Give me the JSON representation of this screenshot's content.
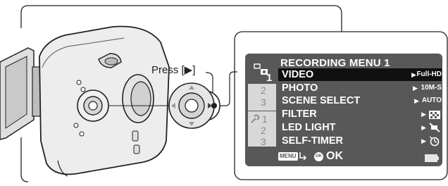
{
  "callout": {
    "press_label": "Press [▶]"
  },
  "menu": {
    "title": "RECORDING MENU 1",
    "tabs": {
      "camera_top": "□",
      "camera_1": "1",
      "camera_2": "2",
      "camera_3": "3",
      "setup_1": "1",
      "setup_2": "2",
      "setup_3": "3"
    },
    "items": [
      {
        "label": "VIDEO",
        "value": "Full-HD",
        "selected": true
      },
      {
        "label": "PHOTO",
        "value": "10M-S",
        "selected": false
      },
      {
        "label": "SCENE SELECT",
        "value": "AUTO",
        "selected": false
      },
      {
        "label": "FILTER",
        "value": "",
        "selected": false
      },
      {
        "label": "LED LIGHT",
        "value": "",
        "selected": false
      },
      {
        "label": "SELF-TIMER",
        "value": "",
        "selected": false
      }
    ],
    "footer": {
      "menu_icon_text": "MENU",
      "ok_icon_text": "OK",
      "ok_label": "OK"
    }
  },
  "icons": [
    "camera-body-icon",
    "control-dial-icon",
    "camera-tab-icon",
    "setup-tab-icon",
    "filter-icon",
    "led-off-icon",
    "self-timer-icon",
    "battery-icon",
    "return-arrow-icon"
  ]
}
